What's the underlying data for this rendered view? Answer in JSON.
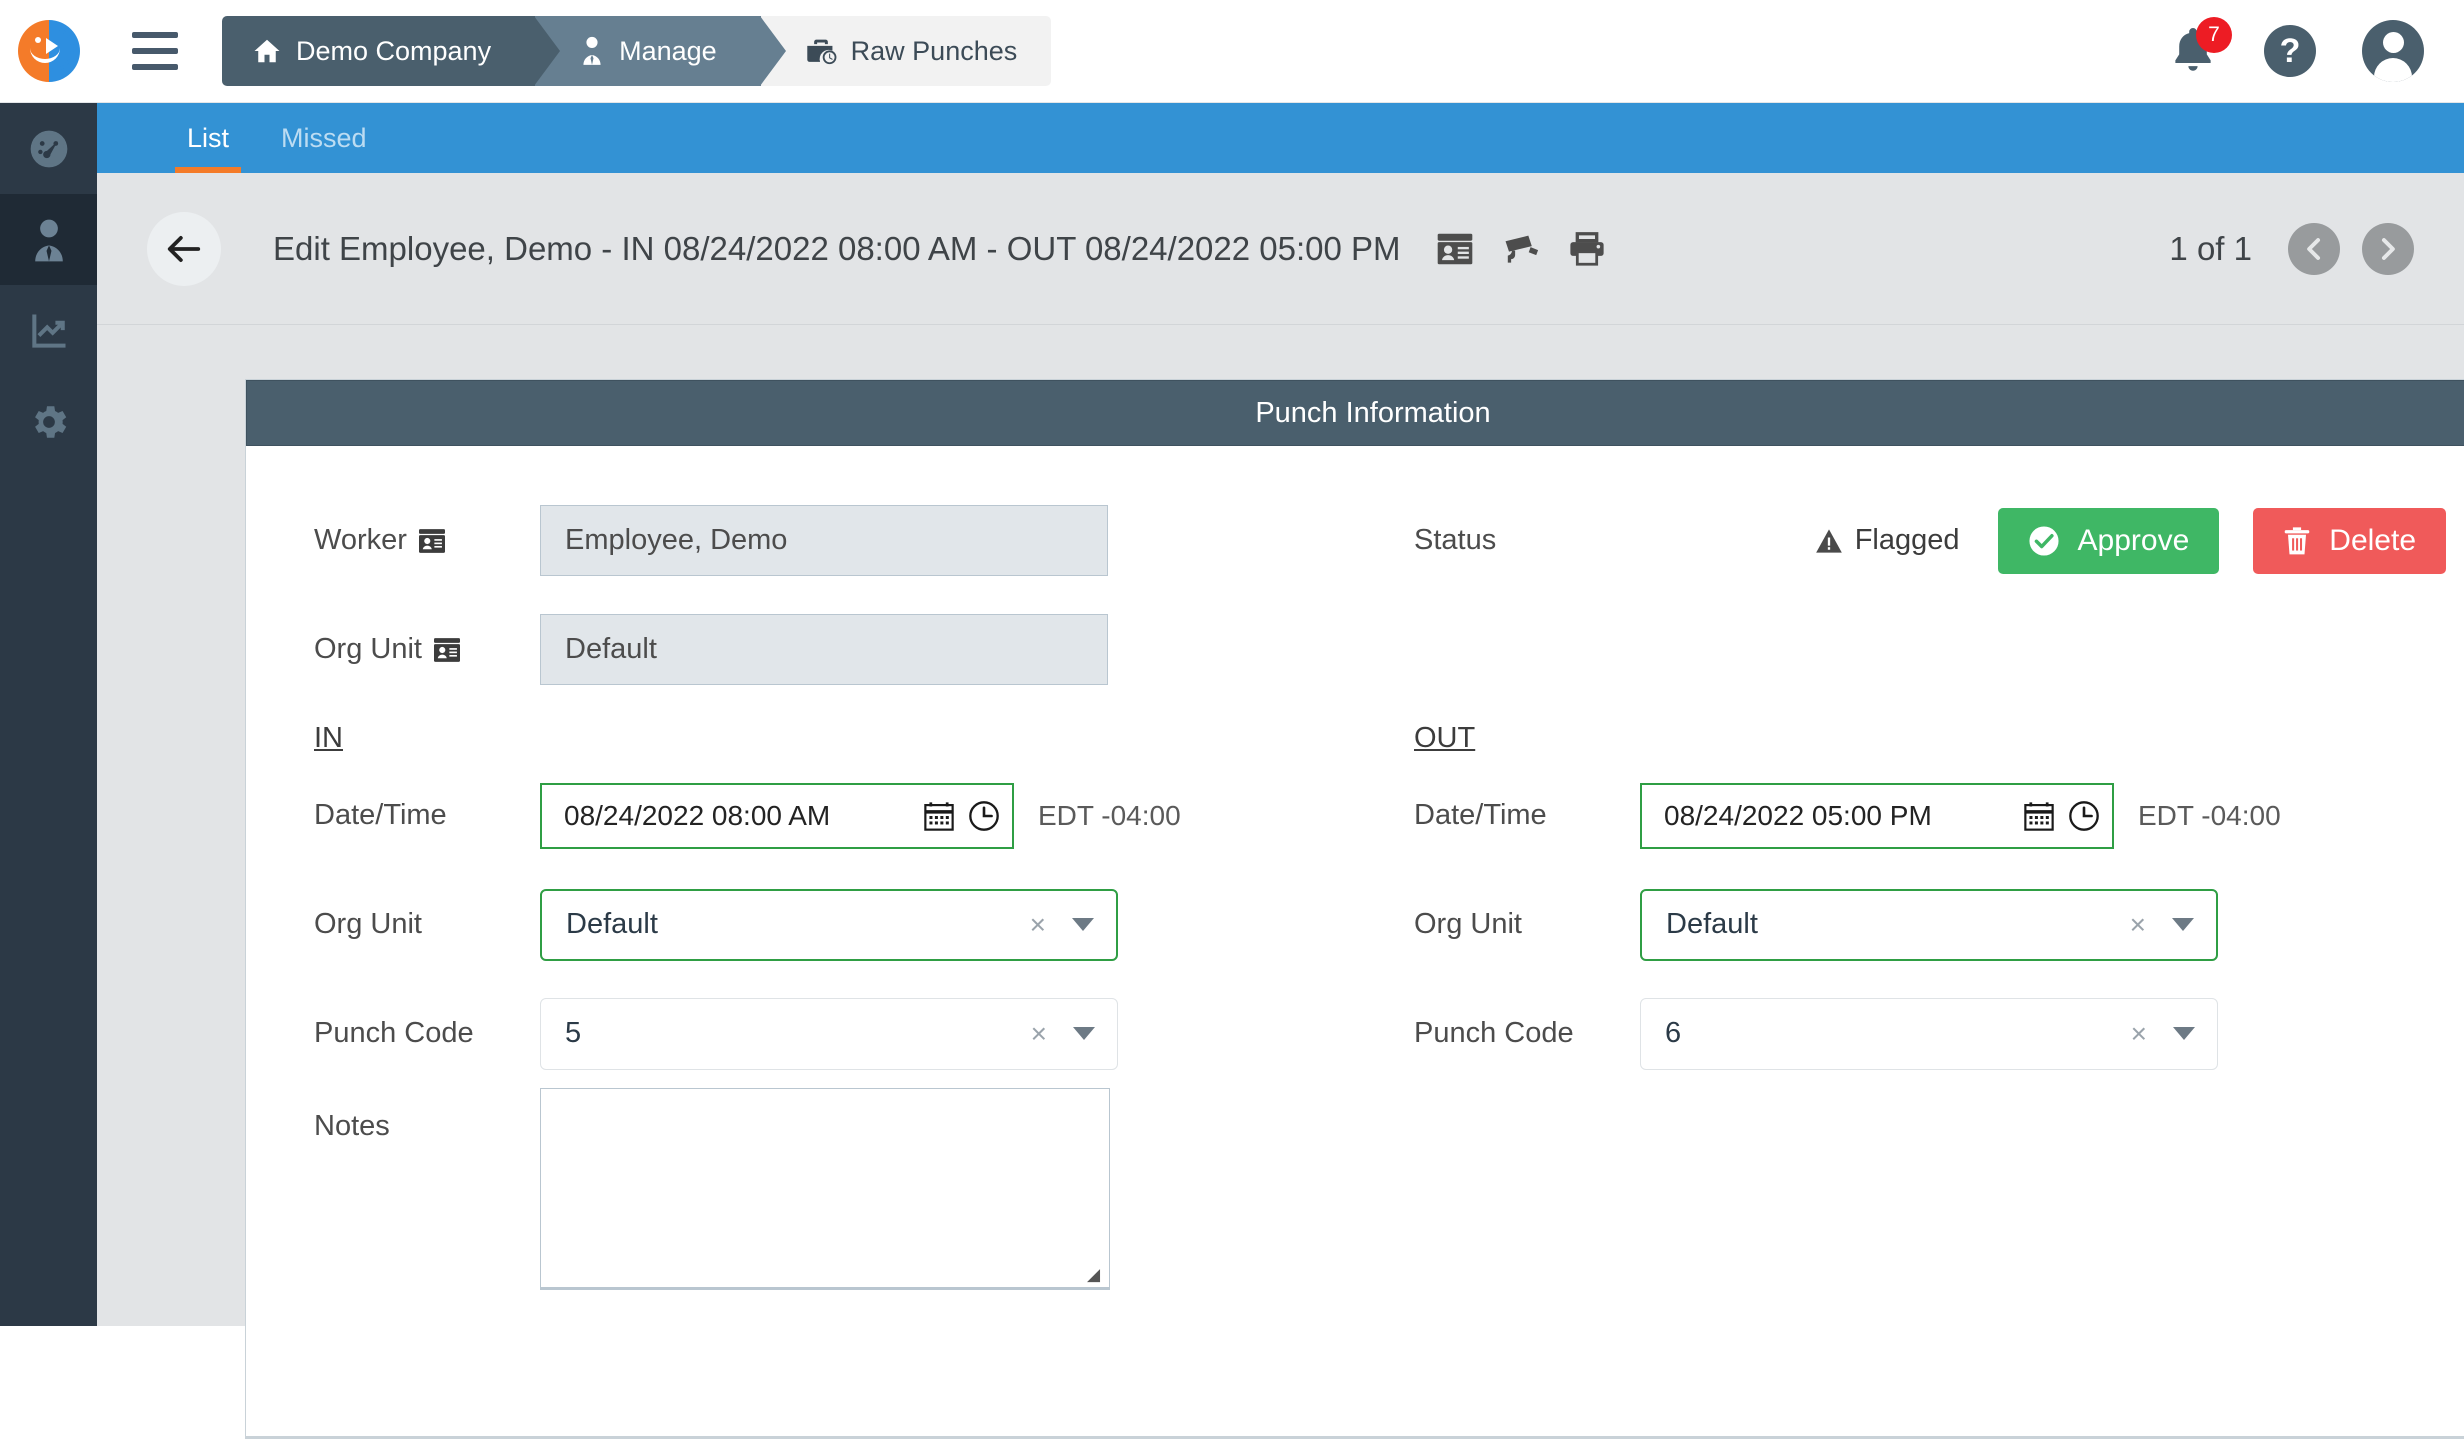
{
  "app": {
    "logo_name": "payroll-clock-logo",
    "accent_orange": "#f47b29",
    "accent_blue": "#3392d4",
    "slate_dark": "#4a5f6d",
    "slate_mid": "#667f91",
    "green": "#2f9e44",
    "approve_green": "#3fb765",
    "delete_red": "#f05a5a",
    "badge_red": "#ed1c24"
  },
  "header": {
    "menu_label": "menu",
    "breadcrumbs": [
      {
        "label": "Demo Company",
        "icon": "home-icon"
      },
      {
        "label": "Manage",
        "icon": "user-tie-icon"
      },
      {
        "label": "Raw Punches",
        "icon": "briefcase-clock-icon"
      }
    ],
    "notifications_count": "7",
    "help_label": "?",
    "avatar_label": "account"
  },
  "sidebar": {
    "items": [
      {
        "name": "dashboard",
        "icon": "gauge-icon",
        "active": false
      },
      {
        "name": "manage",
        "icon": "user-tie-icon",
        "active": true
      },
      {
        "name": "reports",
        "icon": "line-chart-icon",
        "active": false
      },
      {
        "name": "settings",
        "icon": "gear-icon",
        "active": false
      }
    ]
  },
  "tabs": [
    {
      "label": "List",
      "active": true
    },
    {
      "label": "Missed",
      "active": false
    }
  ],
  "title_row": {
    "back_label": "back",
    "title": "Edit Employee, Demo - IN 08/24/2022 08:00 AM - OUT 08/24/2022 05:00 PM",
    "icons": [
      {
        "name": "id-badge-icon"
      },
      {
        "name": "security-camera-icon"
      },
      {
        "name": "printer-icon"
      }
    ],
    "pager_text": "1 of 1",
    "prev_label": "previous",
    "next_label": "next"
  },
  "card": {
    "header_title": "Punch Information",
    "worker": {
      "label": "Worker",
      "icon": "id-card-icon",
      "value": "Employee, Demo"
    },
    "org_unit_readonly": {
      "label": "Org Unit",
      "icon": "id-card-icon",
      "value": "Default"
    },
    "status": {
      "label": "Status",
      "flag_text": "Flagged",
      "flag_icon": "warning-triangle-icon",
      "approve_label": "Approve",
      "approve_icon": "check-circle-icon",
      "delete_label": "Delete",
      "delete_icon": "trash-icon"
    },
    "in_section": {
      "heading": "IN",
      "datetime": {
        "label": "Date/Time",
        "value": "08/24/2022 08:00 AM",
        "calendar_icon": "calendar-icon",
        "clock_icon": "clock-icon",
        "timezone": "EDT -04:00"
      },
      "org_unit": {
        "label": "Org Unit",
        "value": "Default",
        "clear": "×"
      },
      "punch_code": {
        "label": "Punch Code",
        "value": "5",
        "clear": "×"
      },
      "notes": {
        "label": "Notes",
        "value": "",
        "placeholder": ""
      }
    },
    "out_section": {
      "heading": "OUT",
      "datetime": {
        "label": "Date/Time",
        "value": "08/24/2022 05:00 PM",
        "calendar_icon": "calendar-icon",
        "clock_icon": "clock-icon",
        "timezone": "EDT -04:00"
      },
      "org_unit": {
        "label": "Org Unit",
        "value": "Default",
        "clear": "×"
      },
      "punch_code": {
        "label": "Punch Code",
        "value": "6",
        "clear": "×"
      }
    }
  }
}
